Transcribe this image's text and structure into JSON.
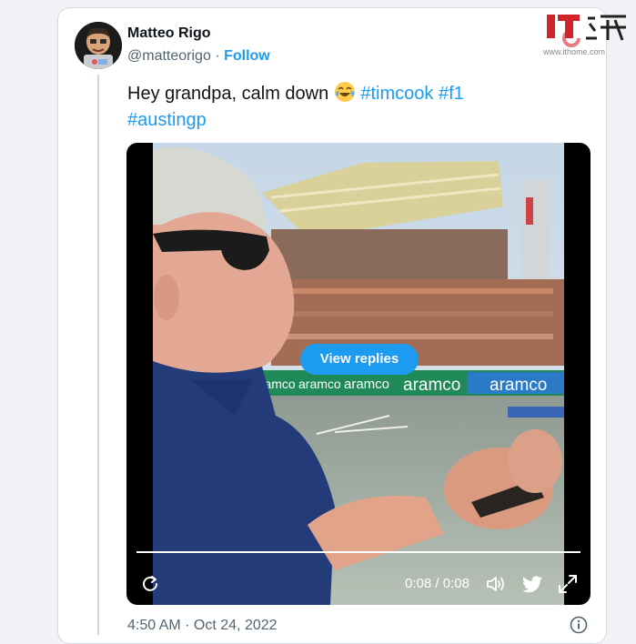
{
  "tweet": {
    "display_name": "Matteo Rigo",
    "handle": "@matteorigo",
    "separator": "·",
    "follow_label": "Follow",
    "text_plain": "Hey grandpa, calm down ",
    "emoji_name": "face-with-tears-of-joy",
    "hashtags": [
      "#timcook",
      "#f1",
      "#austingp"
    ],
    "timestamp": "4:50 AM · Oct 24, 2022"
  },
  "video": {
    "view_replies_label": "View replies",
    "time_current": "0:08",
    "time_separator": " / ",
    "time_total": "0:08",
    "progress_fraction": 1.0,
    "ad_boards": [
      "aramco",
      "aramco",
      "aramco",
      "aramco",
      "aramco"
    ]
  },
  "watermark": {
    "logo_text": "IT之家",
    "url": "www.ithome.com"
  },
  "colors": {
    "accent": "#1d9bf0",
    "text_primary": "#0f1419",
    "text_secondary": "#536471",
    "card_border": "#d6dbe0"
  },
  "icons": [
    "replay-icon",
    "volume-icon",
    "twitter-bird-icon",
    "expand-icon",
    "info-icon"
  ]
}
